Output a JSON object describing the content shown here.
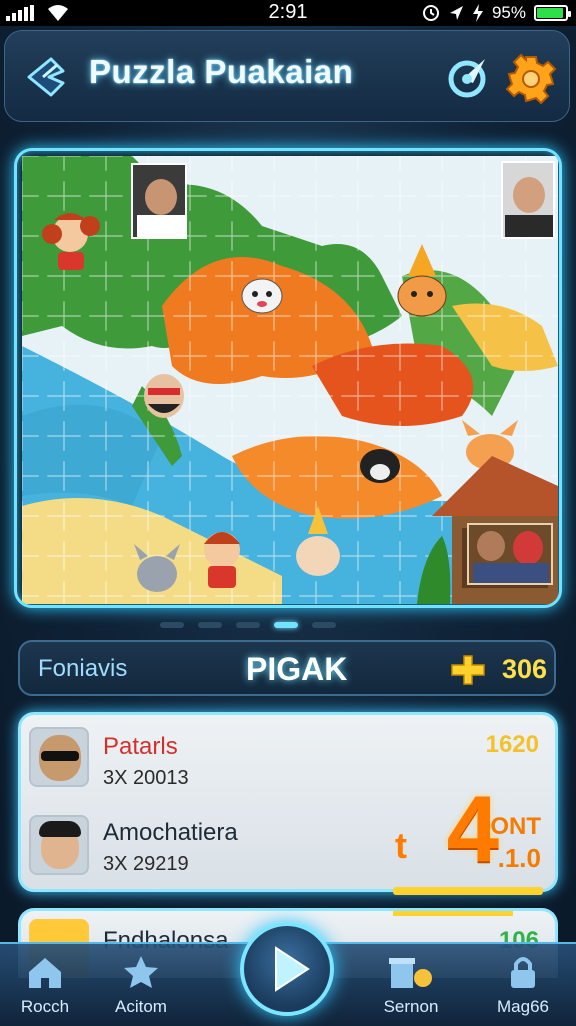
{
  "status_bar": {
    "time": "2:91",
    "battery": "95%"
  },
  "header": {
    "title": "Puzzla Puakaian"
  },
  "board": {
    "pages": 5,
    "active_page": 3
  },
  "info_bar": {
    "label": "Foniavis",
    "mode": "PIGAK",
    "coins": "306"
  },
  "leaderboard": {
    "score": "1620",
    "rank": {
      "prefix": "t",
      "number": "4",
      "suffix": "ONT",
      "decimal": ".1.0"
    },
    "entries": [
      {
        "name": "Patarls",
        "detail": "3X 20013"
      },
      {
        "name": "Amochatiera",
        "detail": "3X 29219"
      }
    ],
    "next": {
      "name": "Fndhalonsa",
      "score": "106"
    }
  },
  "nav": {
    "items": [
      {
        "label": "Rocch"
      },
      {
        "label": "Acitom"
      },
      {
        "label": "Sernon"
      },
      {
        "label": "Mag66"
      }
    ]
  },
  "colors": {
    "accent": "#6fe3ff",
    "coin": "#ffe04a",
    "rank": "#ff7b00",
    "gear": "#ffa31a"
  }
}
